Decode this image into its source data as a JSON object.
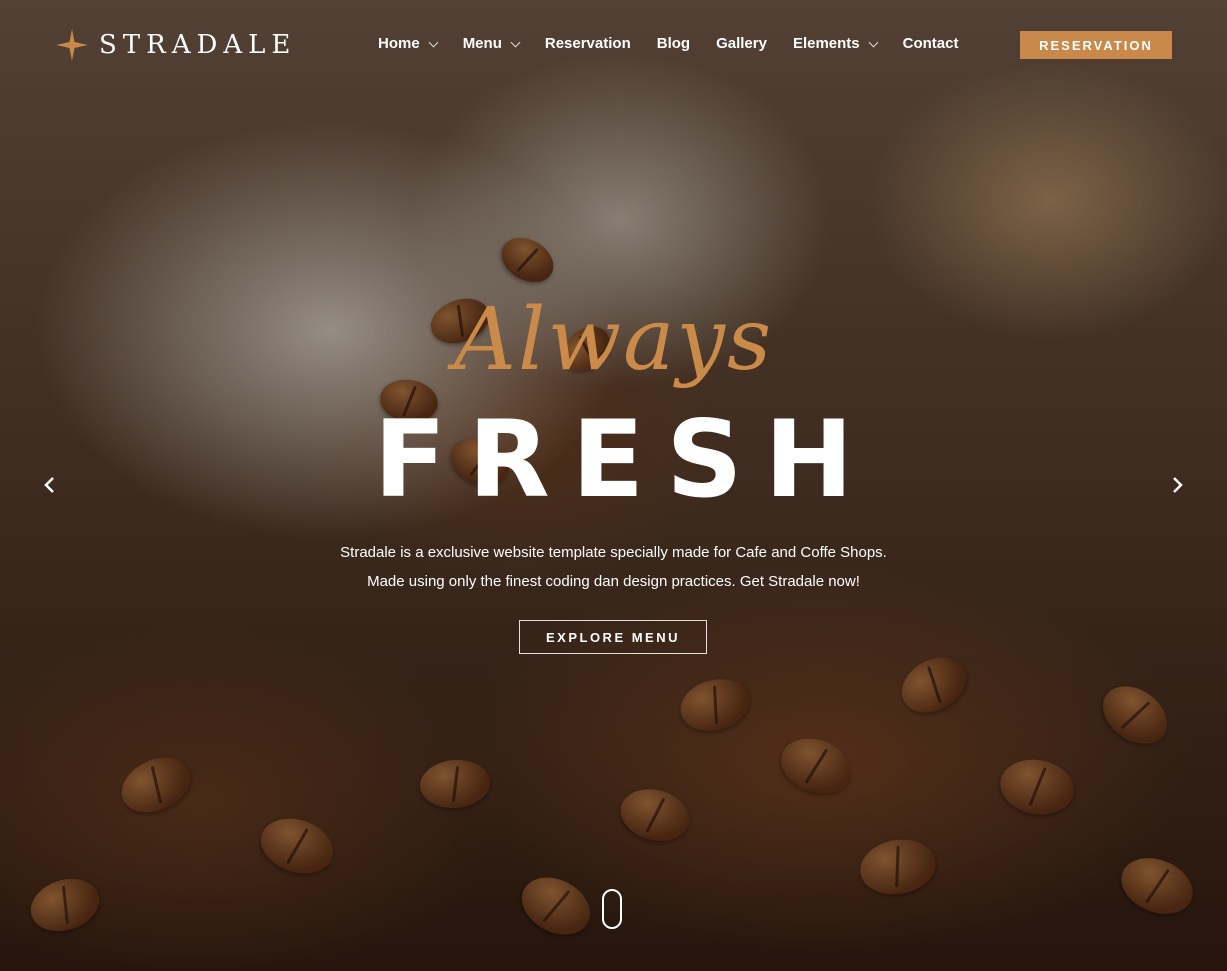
{
  "brand": {
    "name": "STRADALE"
  },
  "nav": {
    "items": [
      {
        "label": "Home",
        "has_dropdown": true
      },
      {
        "label": "Menu",
        "has_dropdown": true
      },
      {
        "label": "Reservation",
        "has_dropdown": false
      },
      {
        "label": "Blog",
        "has_dropdown": false
      },
      {
        "label": "Gallery",
        "has_dropdown": false
      },
      {
        "label": "Elements",
        "has_dropdown": true
      },
      {
        "label": "Contact",
        "has_dropdown": false
      }
    ],
    "cta_label": "RESERVATION"
  },
  "hero": {
    "script_word": "Always",
    "headline": "FRESH",
    "description": "Stradale is a exclusive website template specially made for Cafe and Coffe Shops. Made using only the finest coding dan design practices. Get Stradale now!",
    "button_label": "EXPLORE MENU"
  },
  "icons": {
    "logo": "star-icon",
    "prev": "chevron-left-icon",
    "next": "chevron-right-icon",
    "scroll": "scroll-mouse-icon"
  },
  "colors": {
    "accent": "#c8894a",
    "script": "#c98a4a",
    "text": "#ffffff"
  }
}
